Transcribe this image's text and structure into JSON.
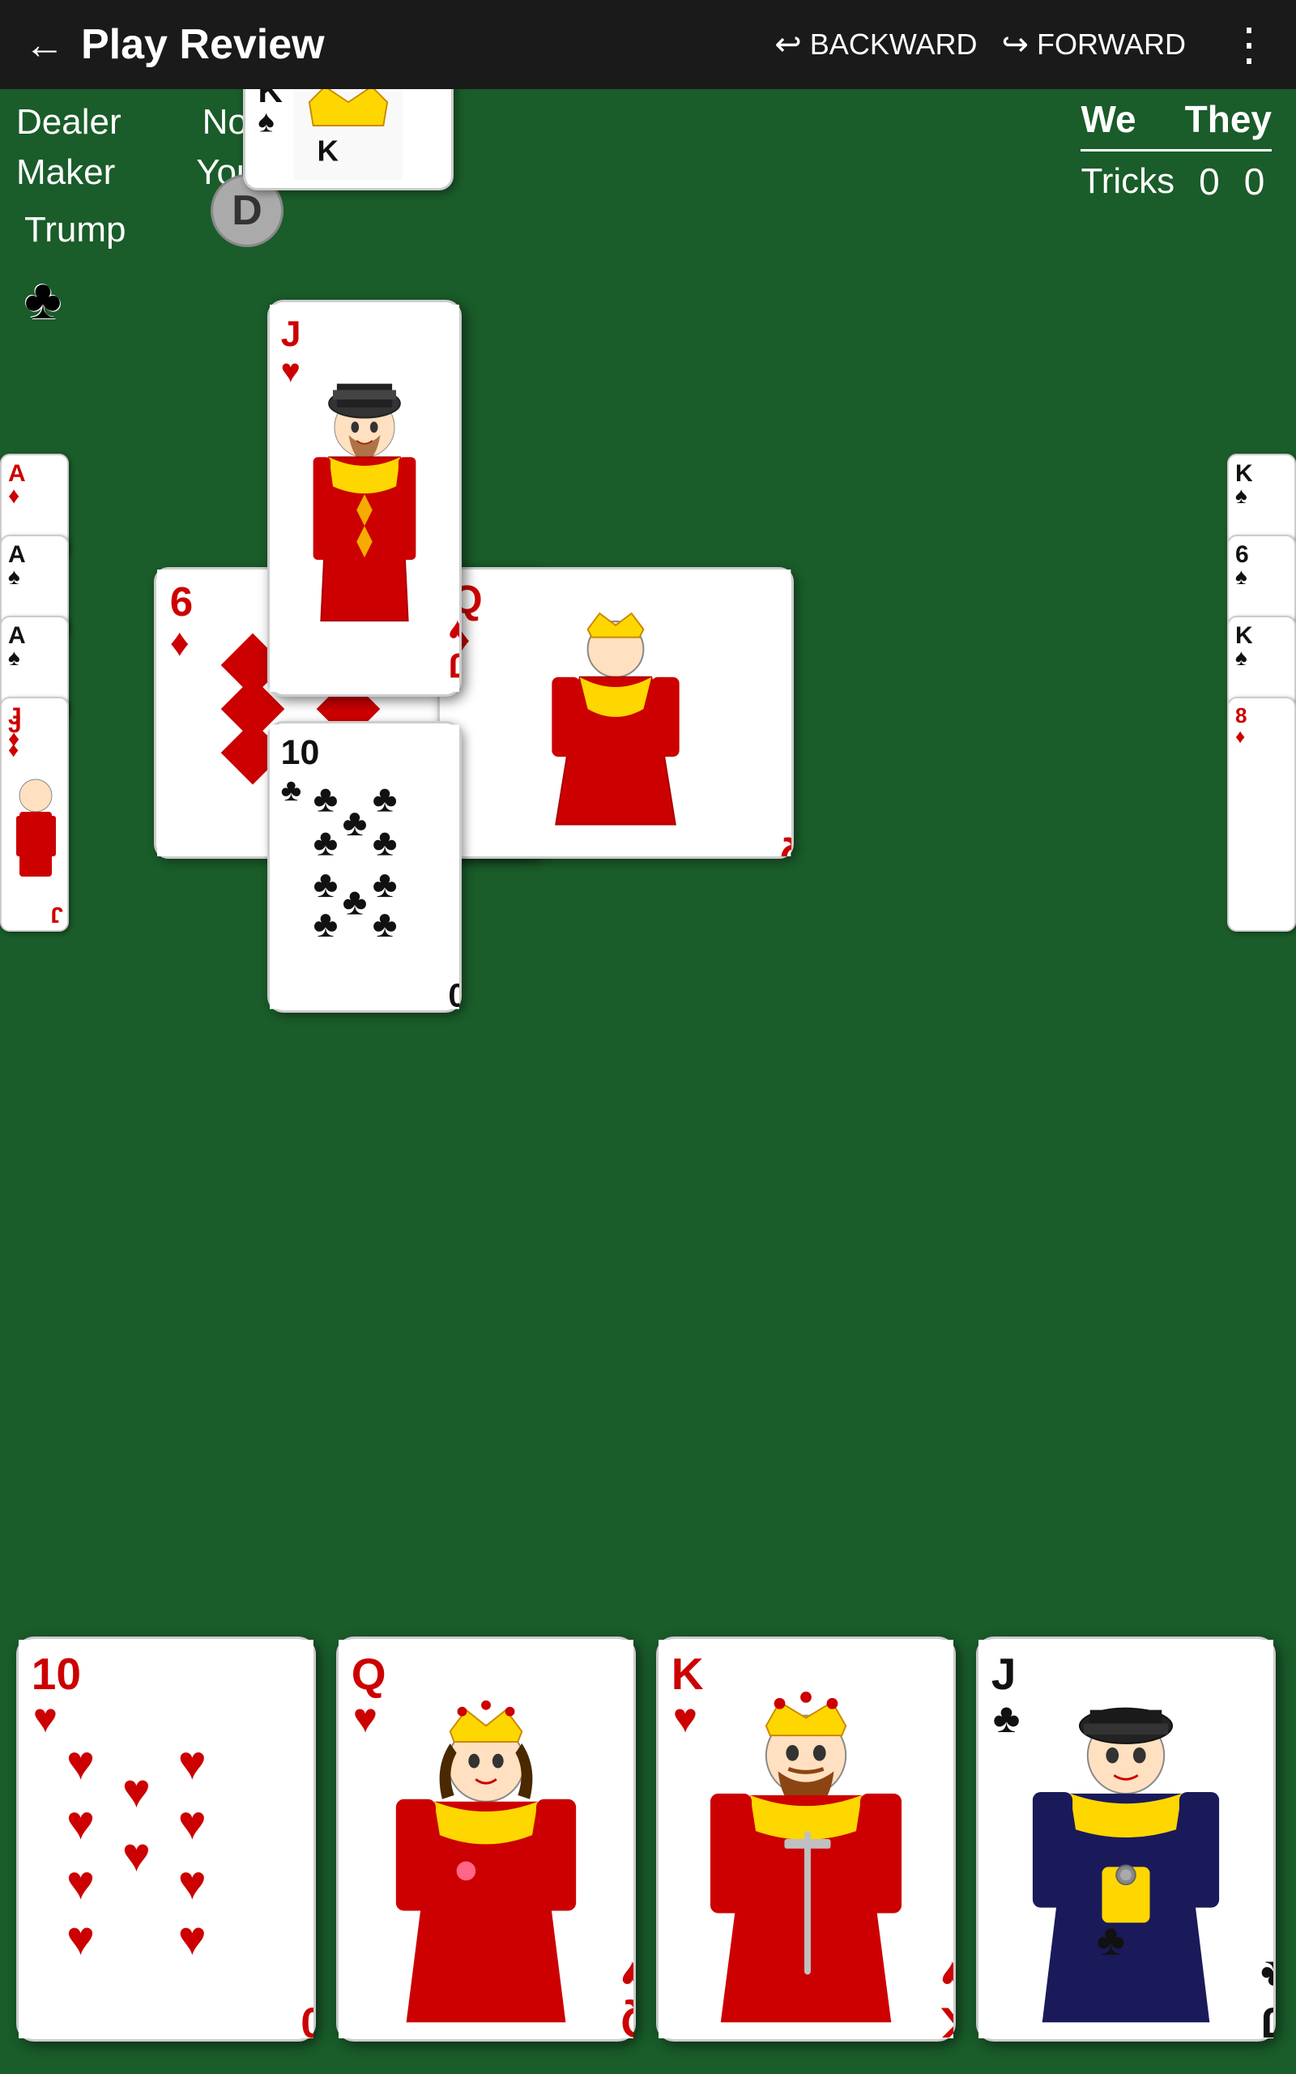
{
  "header": {
    "back_label": "←",
    "title": "Play Review",
    "backward_label": "BACKWARD",
    "forward_label": "FORWARD",
    "menu_label": "⋮"
  },
  "score": {
    "we_label": "We",
    "they_label": "They",
    "tricks_label": "Tricks",
    "we_value": "0",
    "they_value": "0"
  },
  "info": {
    "dealer_label": "Dealer",
    "north_label": "North",
    "maker_label": "Maker",
    "you_label": "You",
    "trump_label": "Trump",
    "trump_suit": "♣",
    "dealer_initial": "D"
  },
  "center_cards": {
    "north": {
      "value": "J",
      "suit": "♥",
      "color": "red"
    },
    "west": {
      "value": "6",
      "suit": "♦",
      "color": "red"
    },
    "east": {
      "value": "Q",
      "suit": "♦",
      "color": "red"
    },
    "south": {
      "value": "10",
      "suit": "♣",
      "color": "black"
    }
  },
  "bottom_hand": [
    {
      "value": "10",
      "suit": "♥",
      "color": "red"
    },
    {
      "value": "Q",
      "suit": "♥",
      "color": "red"
    },
    {
      "value": "K",
      "suit": "♥",
      "color": "red"
    },
    {
      "value": "J",
      "suit": "♣",
      "color": "black"
    }
  ]
}
